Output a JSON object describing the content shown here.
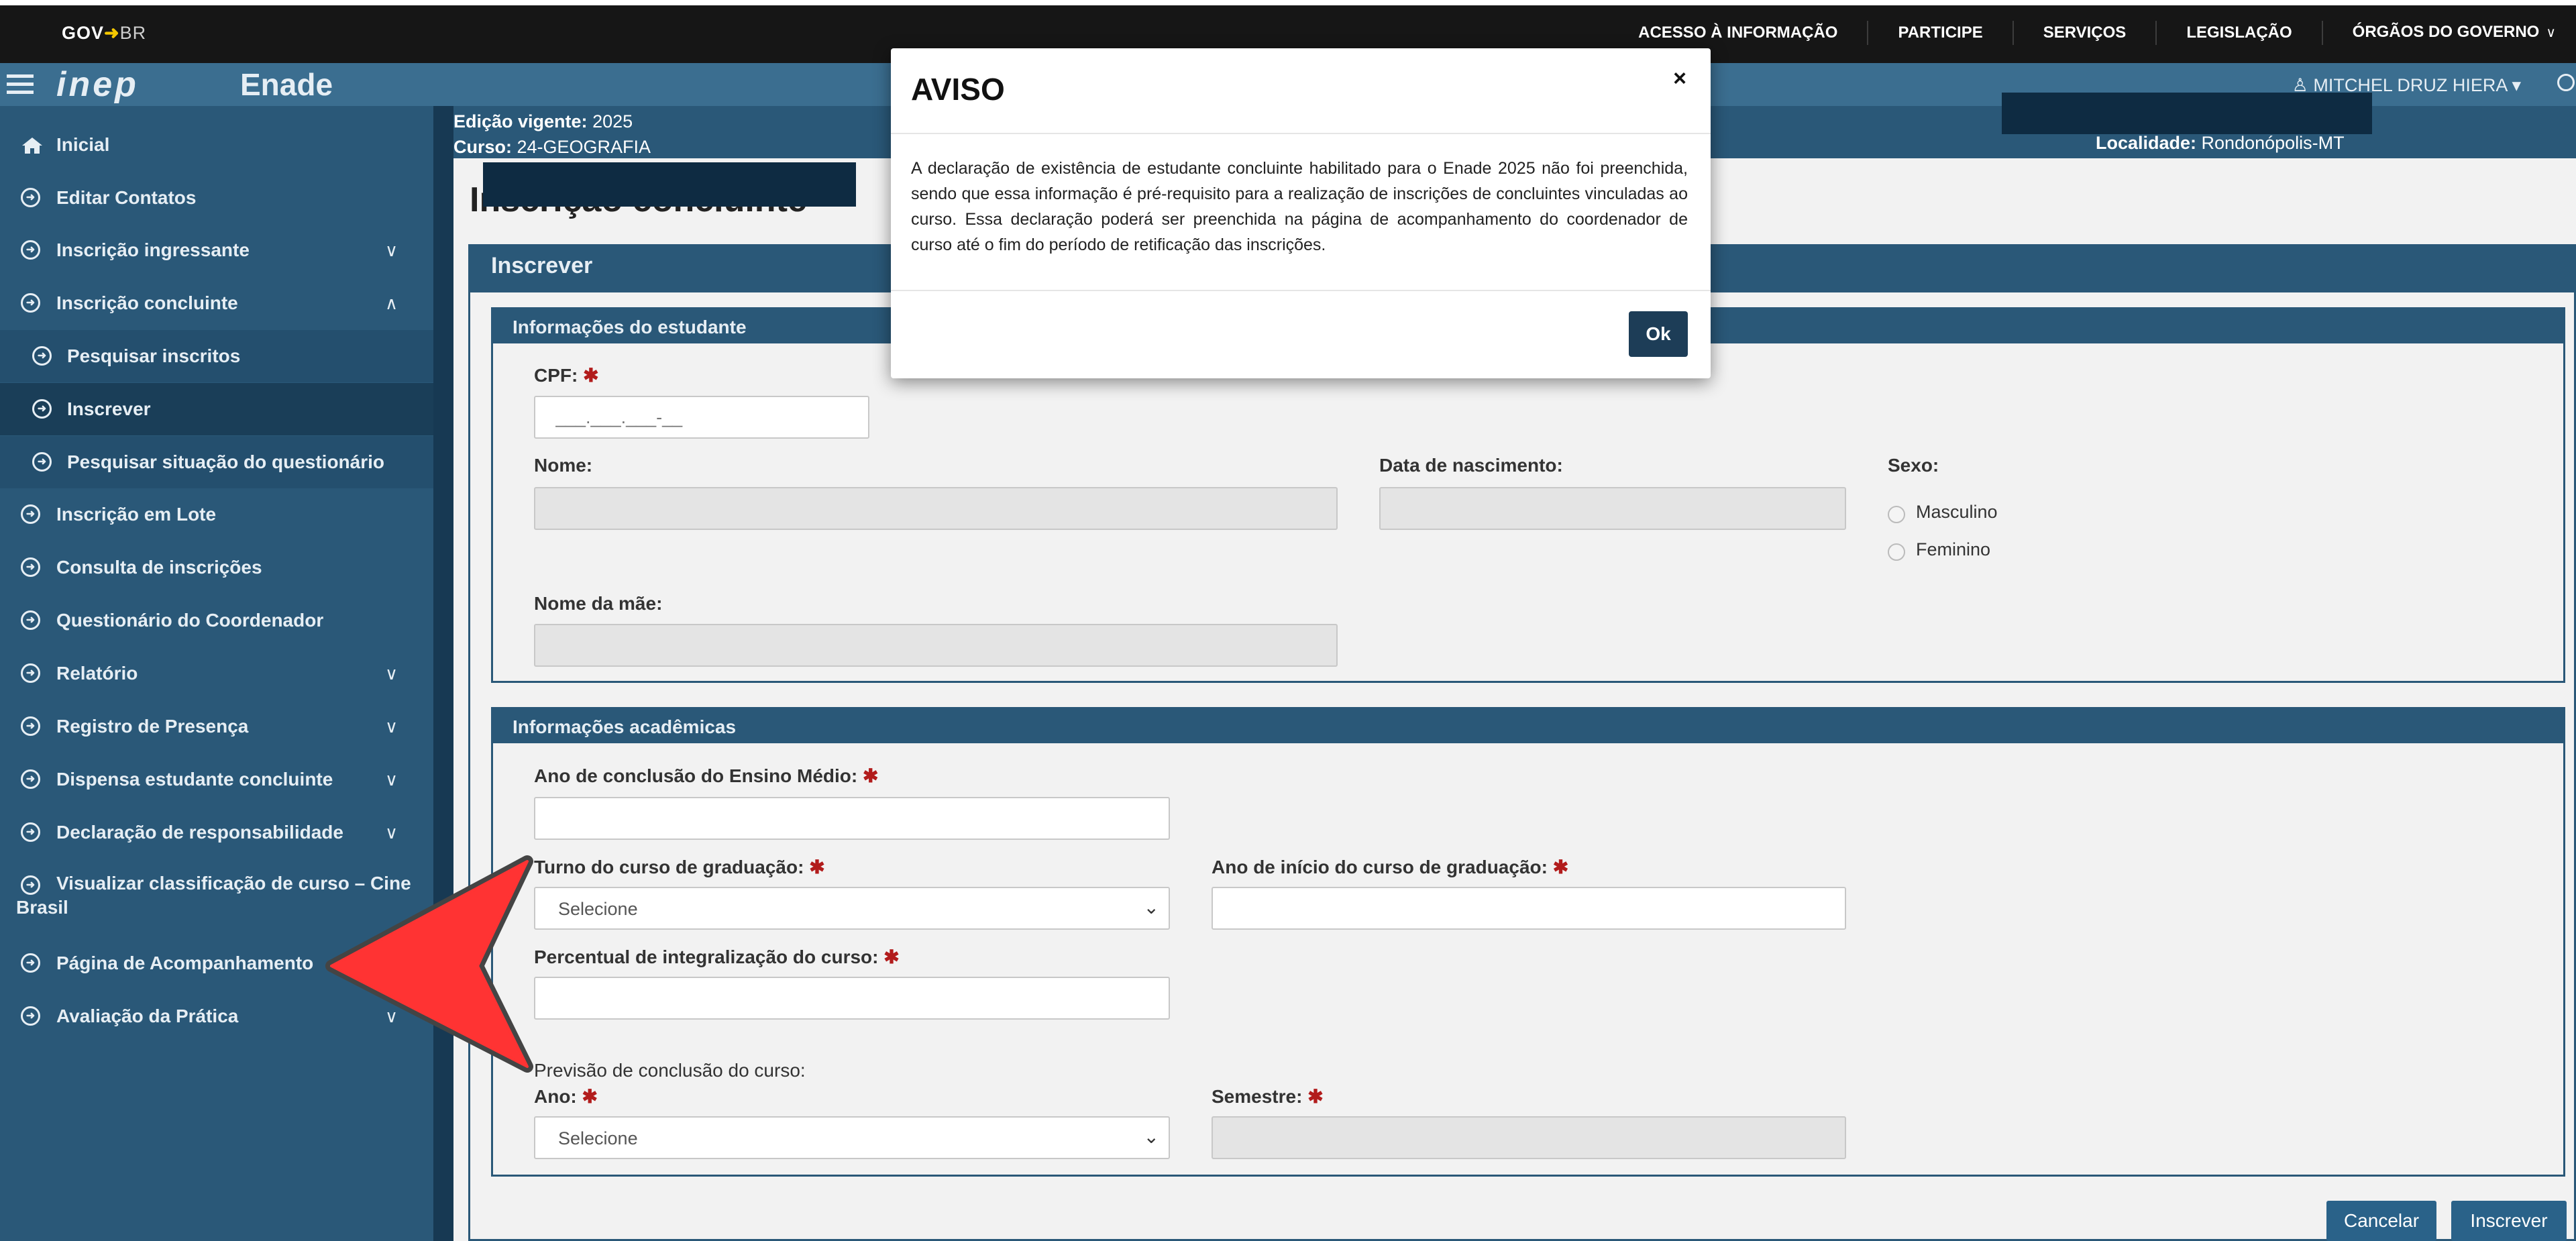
{
  "gov": {
    "logo_gov": "GOV",
    "logo_br": "BR",
    "links": [
      "ACESSO À INFORMAÇÃO",
      "PARTICIPE",
      "SERVIÇOS",
      "LEGISLAÇÃO",
      "ÓRGÃOS DO GOVERNO"
    ]
  },
  "header": {
    "logo": "inep",
    "title": "Enade",
    "user": "MITCHEL DRUZ HIERA"
  },
  "info": {
    "edicao_label": "Edição vigente:",
    "edicao_value": "2025",
    "curso_label": "Curso:",
    "curso_value": "24-GEOGRAFIA",
    "localidade_label": "Localidade:",
    "localidade_value": "Rondonópolis-MT"
  },
  "sidebar": {
    "items": [
      {
        "label": "Inicial"
      },
      {
        "label": "Editar Contatos"
      },
      {
        "label": "Inscrição ingressante"
      },
      {
        "label": "Inscrição concluinte"
      },
      {
        "label": "Pesquisar inscritos"
      },
      {
        "label": "Inscrever"
      },
      {
        "label": "Pesquisar situação do questionário"
      },
      {
        "label": "Inscrição em Lote"
      },
      {
        "label": "Consulta de inscrições"
      },
      {
        "label": "Questionário do Coordenador"
      },
      {
        "label": "Relatório"
      },
      {
        "label": "Registro de Presença"
      },
      {
        "label": "Dispensa estudante concluinte"
      },
      {
        "label": "Declaração de responsabilidade"
      },
      {
        "label": "Visualizar classificação de curso – Cine Brasil"
      },
      {
        "label": "Página de Acompanhamento"
      },
      {
        "label": "Avaliação da Prática"
      }
    ]
  },
  "page": {
    "title": "Inscrição concluinte",
    "panel_title": "Inscrever"
  },
  "student": {
    "section_title": "Informações do estudante",
    "cpf_label": "CPF:",
    "cpf_placeholder": "___.___.___-__",
    "nome_label": "Nome:",
    "nascimento_label": "Data de nascimento:",
    "sexo_label": "Sexo:",
    "sexo_options": [
      "Masculino",
      "Feminino"
    ],
    "mae_label": "Nome da mãe:"
  },
  "academic": {
    "section_title": "Informações acadêmicas",
    "ano_em_label": "Ano de conclusão do Ensino Médio:",
    "turno_label": "Turno do curso de graduação:",
    "turno_value": "Selecione",
    "ano_inicio_label": "Ano de início do curso de graduação:",
    "percentual_label": "Percentual de integralização do curso:",
    "previsao_label": "Previsão de conclusão do curso:",
    "ano_label": "Ano:",
    "ano_value": "Selecione",
    "semestre_label": "Semestre:"
  },
  "actions": {
    "cancel": "Cancelar",
    "submit": "Inscrever"
  },
  "modal": {
    "title": "AVISO",
    "close": "×",
    "body": "A declaração de existência de estudante concluinte habilitado para o Enade 2025 não foi preenchida, sendo que essa informação é pré-requisito para a realização de inscrições de concluintes vinculadas ao curso. Essa declaração poderá ser preenchida na página de acompanhamento do coordenador de curso até o fim do período de retificação das inscrições.",
    "ok": "Ok"
  },
  "colors": {
    "sidebar": "#2a5878",
    "header": "#3b6e90",
    "required": "#b21c1c",
    "arrow": "#ff3333",
    "button": "#2a6289"
  }
}
